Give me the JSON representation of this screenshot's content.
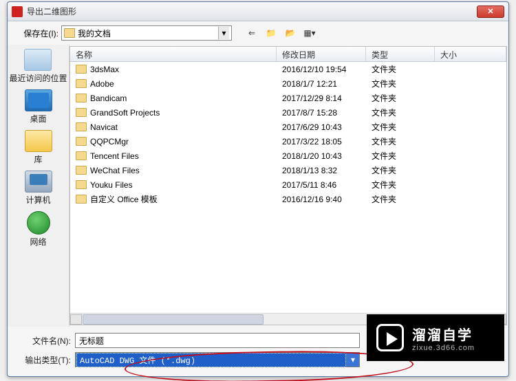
{
  "title": "导出二维图形",
  "toolbar": {
    "savein_label": "保存在(I):",
    "savein_value": "我的文档"
  },
  "columns": {
    "name": "名称",
    "date": "修改日期",
    "type": "类型",
    "size": "大小"
  },
  "sidebar": {
    "recent": "最近访问的位置",
    "desktop": "桌面",
    "libraries": "库",
    "computer": "计算机",
    "network": "网络"
  },
  "rows": [
    {
      "name": "3dsMax",
      "date": "2016/12/10 19:54",
      "type": "文件夹"
    },
    {
      "name": "Adobe",
      "date": "2018/1/7 12:21",
      "type": "文件夹"
    },
    {
      "name": "Bandicam",
      "date": "2017/12/29 8:14",
      "type": "文件夹"
    },
    {
      "name": "GrandSoft Projects",
      "date": "2017/8/7 15:28",
      "type": "文件夹"
    },
    {
      "name": "Navicat",
      "date": "2017/6/29 10:43",
      "type": "文件夹"
    },
    {
      "name": "QQPCMgr",
      "date": "2017/3/22 18:05",
      "type": "文件夹"
    },
    {
      "name": "Tencent Files",
      "date": "2018/1/20 10:43",
      "type": "文件夹"
    },
    {
      "name": "WeChat Files",
      "date": "2018/1/13 8:32",
      "type": "文件夹"
    },
    {
      "name": "Youku Files",
      "date": "2017/5/11 8:46",
      "type": "文件夹"
    },
    {
      "name": "自定义 Office 模板",
      "date": "2016/12/16 9:40",
      "type": "文件夹"
    }
  ],
  "form": {
    "filename_label": "文件名(N):",
    "filename_value": "无标题",
    "type_label": "输出类型(T):",
    "type_value": "AutoCAD DWG 文件 (*.dwg)"
  },
  "watermark": {
    "title": "溜溜自学",
    "sub": "zixue.3d66.com"
  }
}
